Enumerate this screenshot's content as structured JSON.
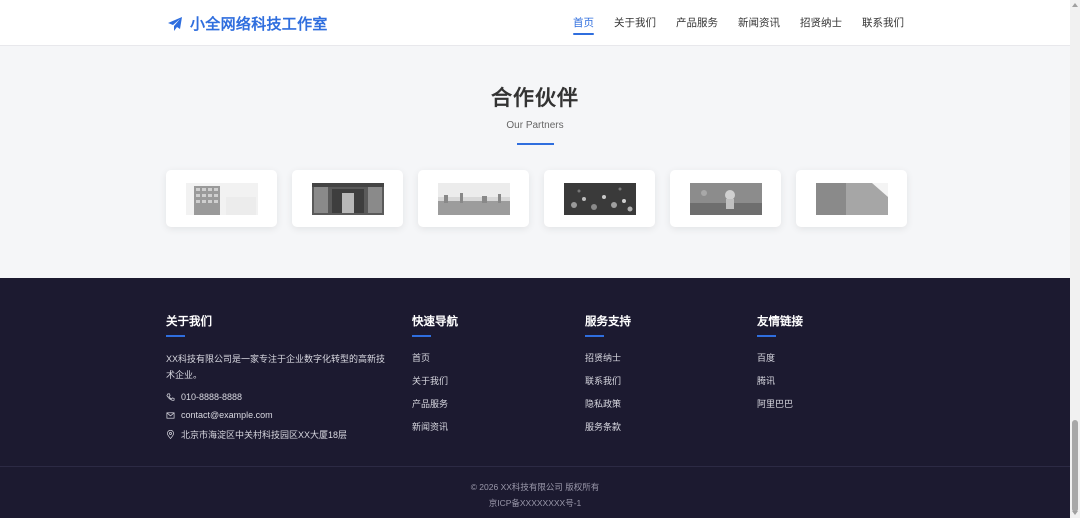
{
  "header": {
    "brand_icon": "paper-plane-icon",
    "brand_name": "小全网络科技工作室",
    "nav": [
      {
        "label": "首页",
        "active": true
      },
      {
        "label": "关于我们"
      },
      {
        "label": "产品服务"
      },
      {
        "label": "新闻资讯"
      },
      {
        "label": "招贤纳士"
      },
      {
        "label": "联系我们"
      }
    ]
  },
  "partners": {
    "title": "合作伙伴",
    "subtitle": "Our Partners",
    "logos": [
      "building-image",
      "library-image",
      "skyline-image",
      "bokeh-lights-image",
      "astronaut-image",
      "wall-image"
    ]
  },
  "footer": {
    "about": {
      "title": "关于我们",
      "text": "XX科技有限公司是一家专注于企业数字化转型的高新技术企业。",
      "phone": "010-8888-8888",
      "email": "contact@example.com",
      "address": "北京市海淀区中关村科技园区XX大厦18层"
    },
    "quick_nav": {
      "title": "快速导航",
      "links": [
        "首页",
        "关于我们",
        "产品服务",
        "新闻资讯"
      ]
    },
    "support": {
      "title": "服务支持",
      "links": [
        "招贤纳士",
        "联系我们",
        "隐私政策",
        "服务条款"
      ]
    },
    "friends": {
      "title": "友情链接",
      "links": [
        "百度",
        "腾讯",
        "阿里巴巴"
      ]
    },
    "copyright": "© 2026 XX科技有限公司 版权所有",
    "icp": "京ICP备XXXXXXXX号-1"
  },
  "colors": {
    "accent": "#2f6ede",
    "footer_bg": "#1c1a30",
    "page_bg": "#f5f6f8"
  }
}
